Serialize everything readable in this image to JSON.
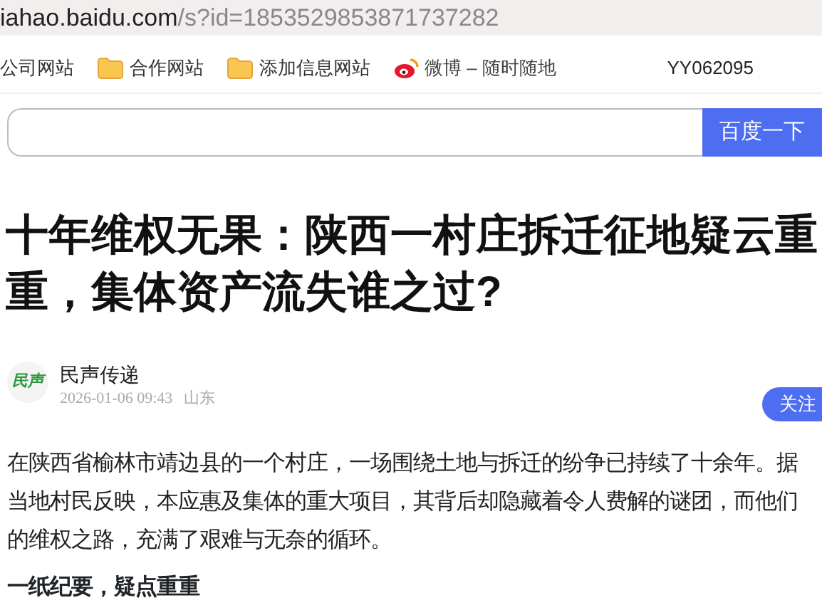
{
  "address_bar": {
    "host": "iahao.baidu.com",
    "path": "/s?id=1853529853871737282"
  },
  "bookmarks": [
    {
      "kind": "plain",
      "label": "公司网站"
    },
    {
      "kind": "folder",
      "label": "合作网站"
    },
    {
      "kind": "folder",
      "label": "添加信息网站"
    },
    {
      "kind": "weibo",
      "label": "微博 – 随时随地"
    }
  ],
  "bookmark_right": "YY062095",
  "search": {
    "button": "百度一下"
  },
  "article": {
    "title": "十年维权无果：陕西一村庄拆迁征地疑云重重，集体资产流失谁之过?",
    "author": {
      "name": "民声传递",
      "logo": "民声",
      "date": "2026-01-06 09:43",
      "location": "山东",
      "follow": "关注"
    },
    "paragraphs": [
      "在陕西省榆林市靖边县的一个村庄，一场围绕土地与拆迁的纷争已持续了十余年。据当地村民反映，本应惠及集体的重大项目，其背后却隐藏着令人费解的谜团，而他们的维权之路，充满了艰难与无奈的循环。"
    ],
    "subheading": "一纸纪要，疑点重重"
  }
}
